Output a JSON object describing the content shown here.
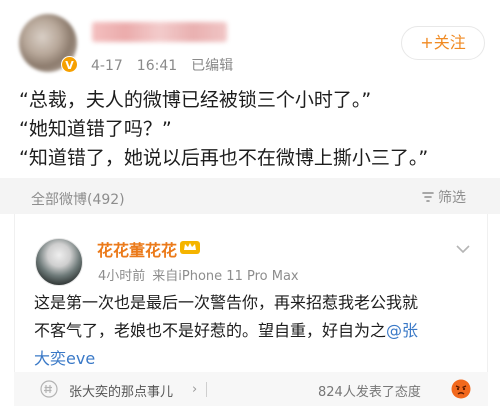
{
  "post": {
    "date": "4-17",
    "time": "16:41",
    "edited_label": "已编辑",
    "follow_label": "+关注",
    "lines": [
      "“总裁，夫人的微博已经被锁三个小时了。”",
      "“她知道错了吗？”",
      "“知道错了，她说以后再也不在微博上撕小三了。”"
    ],
    "verified_badge": "V"
  },
  "comments_header": {
    "all_label": "全部微博(492)",
    "filter_label": "筛选",
    "filter_icon": "filter-icon"
  },
  "comment": {
    "author": "花花董花花",
    "badge_icon": "crown-icon",
    "time_ago": "4小时前",
    "source": "来自iPhone 11 Pro Max",
    "text_line1": "这是第一次也是最后一次警告你，再来招惹我老公我就",
    "text_line2_prefix": "不客气了，老娘也不是好惹的。望自重，好自为之",
    "mention_part1": "@张",
    "mention_part2": "大奕eve"
  },
  "footer": {
    "topic_icon": "topic-icon",
    "topic_text": "张大奕的那点事儿",
    "topic_arrow": "›",
    "reaction_text": "824人发表了态度",
    "reaction_icon": "angry-emoji-icon"
  },
  "colors": {
    "accent_orange": "#eb7a1a",
    "follow_orange": "#f08a22",
    "mention_blue": "#3a79c7",
    "band_gray": "#f4f4f4"
  }
}
